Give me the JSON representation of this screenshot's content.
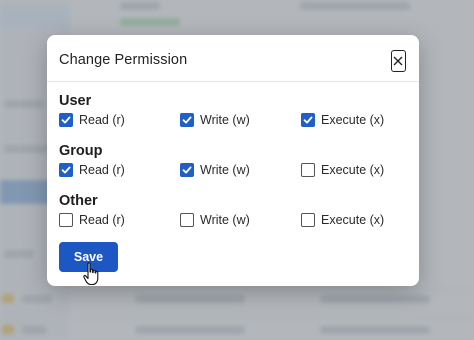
{
  "dialog": {
    "title": "Change Permission",
    "save_label": "Save"
  },
  "groups": [
    {
      "title": "User",
      "options": [
        {
          "label": "Read (r)",
          "checked": true
        },
        {
          "label": "Write (w)",
          "checked": true
        },
        {
          "label": "Execute (x)",
          "checked": true
        }
      ]
    },
    {
      "title": "Group",
      "options": [
        {
          "label": "Read (r)",
          "checked": true
        },
        {
          "label": "Write (w)",
          "checked": true
        },
        {
          "label": "Execute (x)",
          "checked": false
        }
      ]
    },
    {
      "title": "Other",
      "options": [
        {
          "label": "Read (r)",
          "checked": false
        },
        {
          "label": "Write (w)",
          "checked": false
        },
        {
          "label": "Execute (x)",
          "checked": false
        }
      ]
    }
  ],
  "colors": {
    "accent": "#1d57c3",
    "checkbox_checked": "#1f5fc7"
  },
  "icons": {
    "close": "close-icon",
    "check": "checkmark-icon",
    "cursor": "hand-pointer-cursor-icon"
  }
}
